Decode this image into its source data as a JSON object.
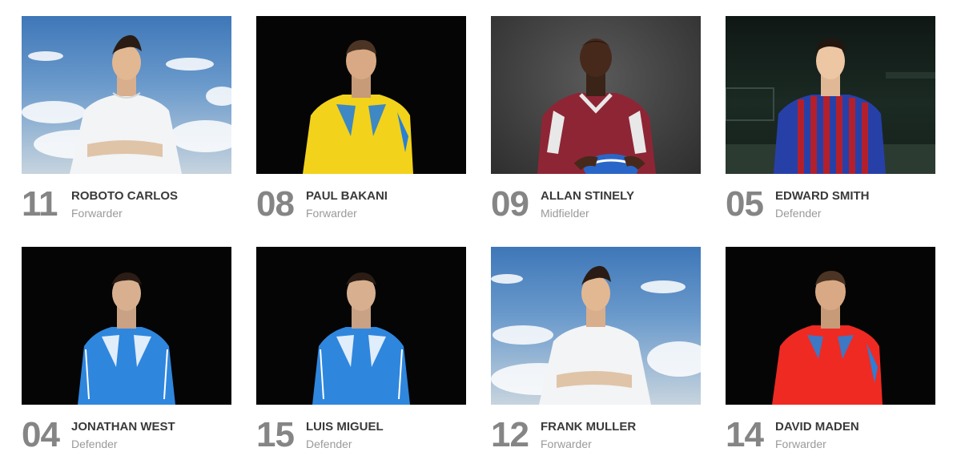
{
  "players": [
    {
      "number": "11",
      "name": "ROBOTO CARLOS",
      "position": "Forwarder",
      "photo": "player-photo-sky-white-shirt"
    },
    {
      "number": "08",
      "name": "PAUL BAKANI",
      "position": "Forwarder",
      "photo": "player-photo-dark-yellow-shirt"
    },
    {
      "number": "09",
      "name": "ALLAN STINELY",
      "position": "Midfielder",
      "photo": "player-photo-grey-maroon-shirt-ball"
    },
    {
      "number": "05",
      "name": "EDWARD SMITH",
      "position": "Defender",
      "photo": "player-photo-stadium-striped-shirt"
    },
    {
      "number": "04",
      "name": "JONATHAN WEST",
      "position": "Defender",
      "photo": "player-photo-dark-blue-shirt"
    },
    {
      "number": "15",
      "name": "LUIS MIGUEL",
      "position": "Defender",
      "photo": "player-photo-dark-blue-shirt"
    },
    {
      "number": "12",
      "name": "FRANK MULLER",
      "position": "Forwarder",
      "photo": "player-photo-sky-white-shirt"
    },
    {
      "number": "14",
      "name": "DAVID MADEN",
      "position": "Forwarder",
      "photo": "player-photo-dark-red-shirt"
    }
  ],
  "colors": {
    "number": "#858585",
    "name": "#3a3a3a",
    "position": "#9a9a9a",
    "jersey_white": "#f2f4f6",
    "jersey_yellow": "#f2d21a",
    "jersey_maroon": "#8e2535",
    "jersey_blue": "#2f86dd",
    "jersey_red": "#ee2a23",
    "jersey_stripe_blue": "#2740a8",
    "jersey_stripe_red": "#b3202c"
  }
}
